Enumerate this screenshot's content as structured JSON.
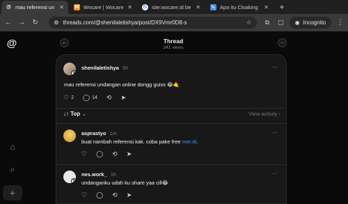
{
  "browser": {
    "tabs": [
      {
        "title": "mau referensi un",
        "favicon": "threads-icon",
        "active": true
      },
      {
        "title": "Wocare | Wocare",
        "favicon": "W",
        "active": false
      },
      {
        "title": "site:wocare.id be",
        "favicon": "G",
        "active": false
      },
      {
        "title": "Apa itu Cloaking",
        "favicon": "doc-icon",
        "active": false
      }
    ],
    "url": "threads.com/@shenilaletishya/post/DX9Vmr0D8-s",
    "incognito_label": "Incognito"
  },
  "thread": {
    "title": "Thread",
    "views": "341 views"
  },
  "main_post": {
    "username": "shenilaletishya",
    "time": "3h",
    "text": "mau referensi undangan online dongg guiss 😂🤙",
    "likes": "2",
    "replies": "14"
  },
  "sort": {
    "label": "Top",
    "view_activity": "View activity"
  },
  "replies": [
    {
      "username": "asprastyo",
      "time": "1m",
      "text_before": "buat nambah referensi kak. coba pake free ",
      "link": "mer.id",
      "text_after": "."
    },
    {
      "username": "nes.work_",
      "time": "1h",
      "text": "undanganku udah ku share yaa cill😂"
    }
  ],
  "colors": {
    "background": "#0a0a0a",
    "card": "#181818",
    "link": "#4c8fff",
    "chrome_toolbar": "#3a3a3a"
  }
}
